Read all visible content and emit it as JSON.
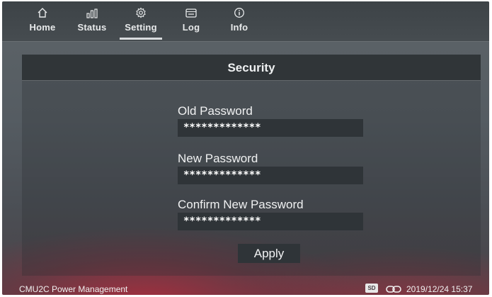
{
  "nav": {
    "tabs": [
      {
        "label": "Home",
        "icon": "home-icon"
      },
      {
        "label": "Status",
        "icon": "bar-chart-icon"
      },
      {
        "label": "Setting",
        "icon": "gear-icon",
        "active": true
      },
      {
        "label": "Log",
        "icon": "log-icon"
      },
      {
        "label": "Info",
        "icon": "info-icon"
      }
    ]
  },
  "security": {
    "title": "Security",
    "old_password_label": "Old Password",
    "old_password_value": "*************",
    "new_password_label": "New Password",
    "new_password_value": "*************",
    "confirm_password_label": "Confirm New Password",
    "confirm_password_value": "*************",
    "apply_label": "Apply"
  },
  "status": {
    "app_name": "CMU2C Power Management",
    "sd_badge": "SD",
    "datetime": "2019/12/24 15:37"
  },
  "colors": {
    "accent_underline": "#d9dcde",
    "field_background": "#2f3438",
    "bottom_glow": "#c8283c"
  }
}
